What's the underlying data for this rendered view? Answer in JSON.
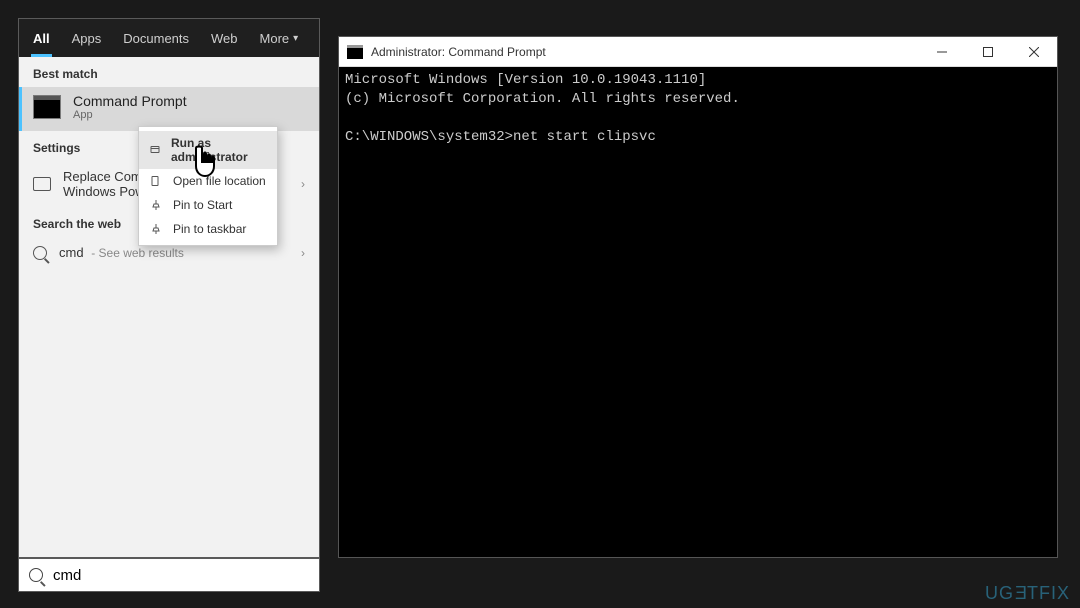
{
  "search": {
    "tabs": {
      "all": "All",
      "apps": "Apps",
      "documents": "Documents",
      "web": "Web",
      "more": "More"
    },
    "best_match_header": "Best match",
    "best_match": {
      "title": "Command Prompt",
      "subtitle": "App"
    },
    "settings_header": "Settings",
    "settings_item": "Replace Command Prompt with Windows PowerShell",
    "settings_item_visible": "Replace Comm\nWindows Pow",
    "web_header": "Search the web",
    "web_query": "cmd",
    "web_suffix": "- See web results",
    "input_value": "cmd"
  },
  "context_menu": {
    "run_admin": "Run as administrator",
    "open_location": "Open file location",
    "pin_start": "Pin to Start",
    "pin_taskbar": "Pin to taskbar"
  },
  "terminal": {
    "title": "Administrator: Command Prompt",
    "line1": "Microsoft Windows [Version 10.0.19043.1110]",
    "line2": "(c) Microsoft Corporation. All rights reserved.",
    "prompt": "C:\\WINDOWS\\system32>",
    "command": "net start clipsvc"
  },
  "watermark": "UGETFIX"
}
